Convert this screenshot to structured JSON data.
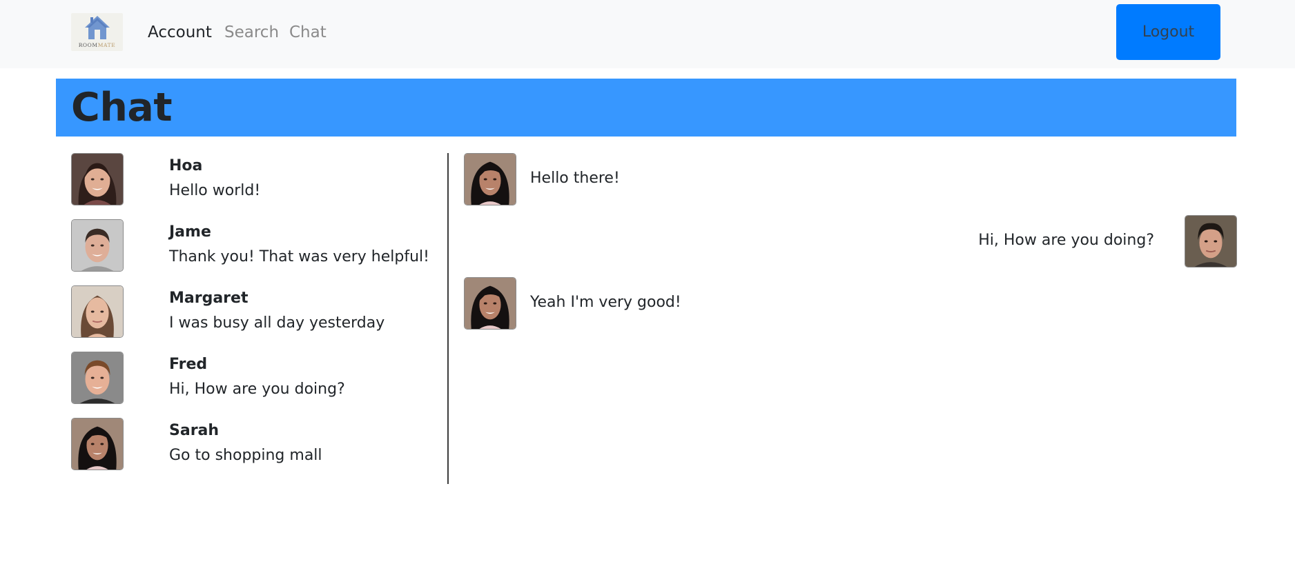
{
  "navbar": {
    "logo": {
      "text_room": "ROOM",
      "text_mate": "MATE",
      "icon": "house-icon"
    },
    "links": [
      {
        "label": "Account",
        "active": true
      },
      {
        "label": "Search",
        "active": false
      },
      {
        "label": "Chat",
        "active": false
      }
    ],
    "logout_label": "Logout"
  },
  "banner": {
    "title": "Chat"
  },
  "contacts": [
    {
      "name": "Hoa",
      "preview": "Hello world!",
      "avatar": "woman-curly-hair-avatar"
    },
    {
      "name": "Jame",
      "preview": "Thank you! That was very helpful!",
      "avatar": "man-short-hair-avatar"
    },
    {
      "name": "Margaret",
      "preview": "I was busy all day yesterday",
      "avatar": "woman-long-hair-avatar"
    },
    {
      "name": "Fred",
      "preview": "Hi, How are you doing?",
      "avatar": "man-brown-hair-avatar"
    },
    {
      "name": "Sarah",
      "preview": "Go to shopping mall",
      "avatar": "woman-dark-hair-avatar"
    }
  ],
  "messages": [
    {
      "direction": "incoming",
      "text": "Hello there!",
      "avatar": "woman-dark-hair-avatar"
    },
    {
      "direction": "outgoing",
      "text": "Hi, How are you doing?",
      "avatar": "man-dark-hair-avatar"
    },
    {
      "direction": "incoming",
      "text": "Yeah I'm very good!",
      "avatar": "woman-dark-hair-avatar"
    }
  ],
  "colors": {
    "navbar_bg": "#f8f9fa",
    "logout_bg": "#007bff",
    "banner_bg": "#3797ff",
    "text": "#212529",
    "muted_link": "#8a8a8a"
  }
}
